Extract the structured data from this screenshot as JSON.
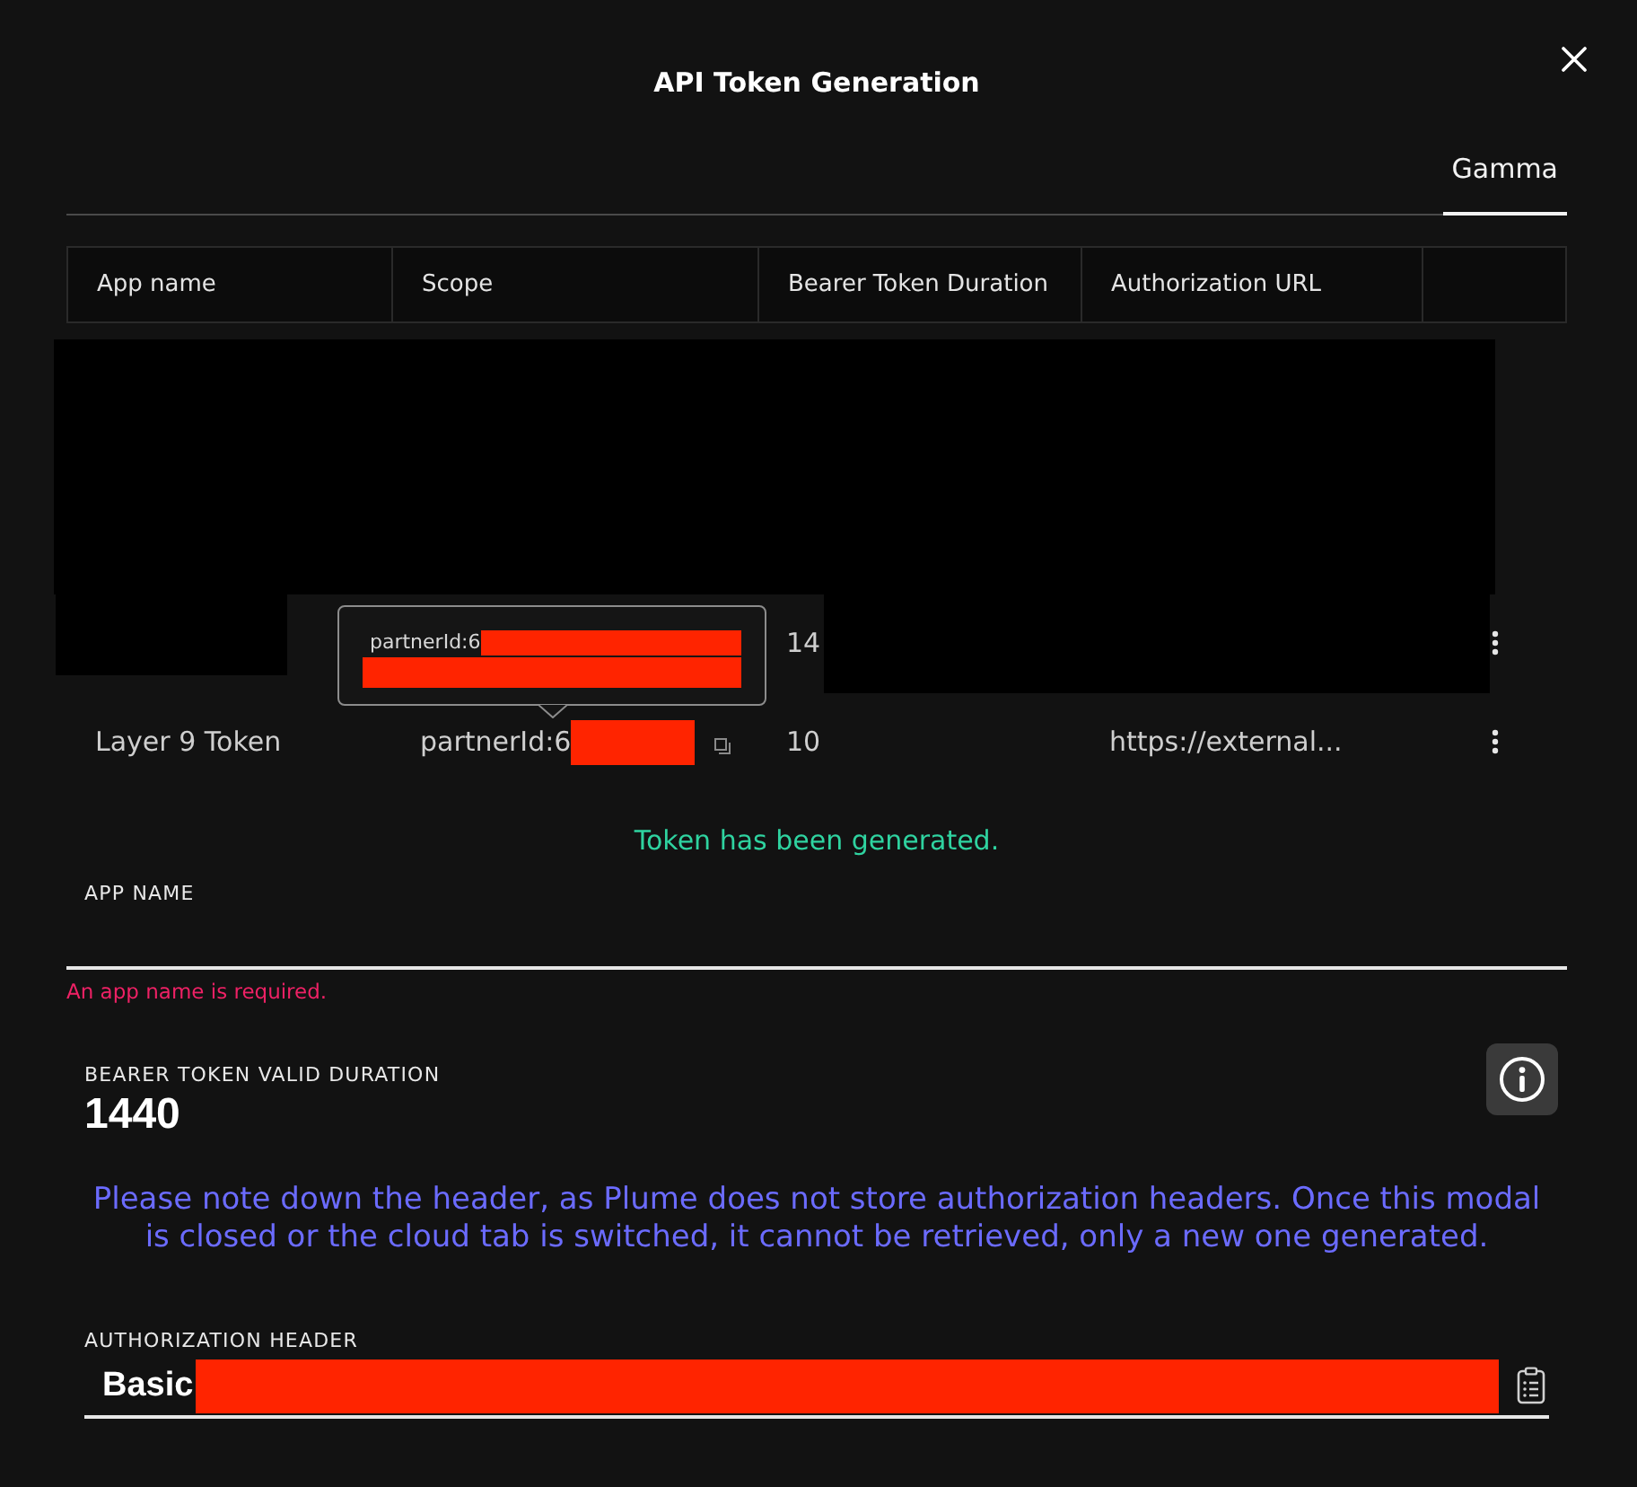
{
  "modal": {
    "title": "API Token Generation"
  },
  "tabs": [
    {
      "label": "Gamma",
      "selected": true
    }
  ],
  "table": {
    "columns": [
      "App name",
      "Scope",
      "Bearer Token Duration",
      "Authorization URL"
    ],
    "rows": [
      {
        "kind": "redacted"
      },
      {
        "kind": "redacted"
      },
      {
        "kind": "redacted"
      },
      {
        "kind": "data",
        "cells": {
          "app_name": {
            "redaction": {
              "color": "#000000"
            }
          },
          "duration": {
            "text": "14",
            "redaction": {
              "color": "#000000"
            }
          },
          "url": {
            "redaction": {
              "color": "#000000"
            }
          }
        }
      },
      {
        "kind": "data",
        "cells": {
          "app_name": {
            "text": "Layer 9 Token"
          },
          "scope": {
            "text": "partnerId:6",
            "redaction": {
              "color": "#ff2400"
            },
            "copy": true,
            "tooltip": {
              "text": "partnerId:6",
              "redaction": {
                "color": "#ff2400"
              }
            }
          },
          "duration": {
            "text": "10"
          },
          "url": {
            "text": "https://external..."
          }
        }
      }
    ]
  },
  "status_message": "Token has been generated.",
  "app_name_field": {
    "label": "APP NAME",
    "error": "An app name is required."
  },
  "duration_field": {
    "label": "BEARER TOKEN VALID DURATION",
    "value": "1440"
  },
  "notice": "Please note down the header, as Plume does not store authorization headers. Once this modal is closed or the cloud tab is switched, it cannot be retrieved, only a new one generated.",
  "authorization_header": {
    "label": "AUTHORIZATION HEADER",
    "value": "Basic",
    "redaction": {
      "color": "#ff2400"
    }
  }
}
